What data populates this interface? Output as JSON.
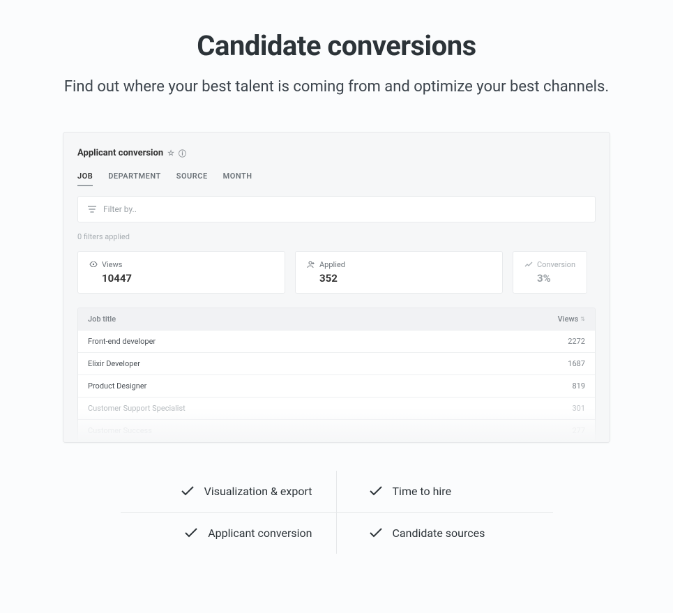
{
  "hero": {
    "title": "Candidate conversions",
    "subtitle": "Find out where your best talent is coming from and optimize your best channels."
  },
  "panel": {
    "title": "Applicant conversion",
    "tabs": [
      "JOB",
      "DEPARTMENT",
      "SOURCE",
      "MONTH"
    ],
    "filter_placeholder": "Filter by..",
    "filters_applied": "0 filters applied",
    "stats": {
      "views": {
        "label": "Views",
        "value": "10447"
      },
      "applied": {
        "label": "Applied",
        "value": "352"
      },
      "conversion": {
        "label": "Conversion",
        "value": "3%"
      }
    },
    "table": {
      "headers": {
        "job": "Job title",
        "views": "Views"
      },
      "rows": [
        {
          "title": "Front-end developer",
          "views": "2272"
        },
        {
          "title": "Elixir Developer",
          "views": "1687"
        },
        {
          "title": "Product Designer",
          "views": "819"
        },
        {
          "title": "Customer Support Specialist",
          "views": "301"
        },
        {
          "title": "Customer Success",
          "views": "277"
        }
      ]
    }
  },
  "features": {
    "top_left": "Visualization & export",
    "top_right": "Time to hire",
    "bottom_left": "Applicant conversion",
    "bottom_right": "Candidate sources"
  }
}
